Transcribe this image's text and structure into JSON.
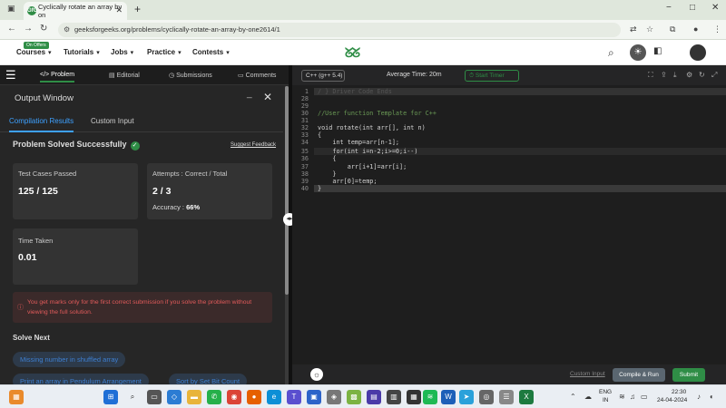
{
  "browser": {
    "tab_title": "Cyclically rotate an array by on",
    "tab_favicon": "GfG",
    "new_tab": "+",
    "url": "geeksforgeeks.org/problems/cyclically-rotate-an-array-by-one2614/1",
    "win_min": "−",
    "win_max": "□",
    "win_close": "✕"
  },
  "sitenav": {
    "offer_badge": "On Offers",
    "courses": "Courses",
    "tutorials": "Tutorials",
    "jobs": "Jobs",
    "practice": "Practice",
    "contests": "Contests",
    "caret": "▾"
  },
  "leftpane": {
    "tabs": {
      "problem": "</> Problem",
      "editorial": "Editorial",
      "submissions": "Submissions",
      "comments": "Comments"
    },
    "output_window": {
      "title": "Output Window",
      "minimize": "_",
      "close": "✕"
    },
    "subtabs": {
      "compilation": "Compilation Results",
      "custom_input": "Custom Input"
    },
    "status": "Problem Solved Successfully",
    "status_check": "✓",
    "suggest_feedback": "Suggest Feedback",
    "cards": {
      "test_cases_label": "Test Cases Passed",
      "test_cases_value": "125 / 125",
      "attempts_label": "Attempts : Correct / Total",
      "attempts_value": "2 / 3",
      "accuracy_label": "Accuracy :",
      "accuracy_value": "66%",
      "time_label": "Time Taken",
      "time_value": "0.01"
    },
    "warning_icon": "ⓘ",
    "warning": "You get marks only for the first correct submission if you solve the problem without viewing the full solution.",
    "solve_next": "Solve Next",
    "suggestions": [
      "Missing number in shuffled array",
      "Print an array in Pendulum Arrangement",
      "Sort by Set Bit Count"
    ]
  },
  "editor": {
    "language": "C++ (g++ 5.4)",
    "average_time": "Average Time: 20m",
    "timer": "Start Timer",
    "lines": [
      {
        "n": "1",
        "code": "/ } Driver Code Ends"
      },
      {
        "n": "28",
        "code": ""
      },
      {
        "n": "29",
        "code": ""
      },
      {
        "n": "30",
        "code": "//User function Template for C++"
      },
      {
        "n": "31",
        "code": ""
      },
      {
        "n": "32",
        "code": "void rotate(int arr[], int n)"
      },
      {
        "n": "33",
        "code": "{"
      },
      {
        "n": "34",
        "code": "    int temp=arr[n-1];"
      },
      {
        "n": "35",
        "code": "    for(int i=n-2;i>=0;i--)"
      },
      {
        "n": "36",
        "code": "    {"
      },
      {
        "n": "37",
        "code": "        arr[i+1]=arr[i];"
      },
      {
        "n": "38",
        "code": "    }"
      },
      {
        "n": "39",
        "code": "    arr[0]=temp;"
      },
      {
        "n": "40",
        "code": "}"
      }
    ],
    "custom_input": "Custom Input",
    "compile_run": "Compile & Run",
    "submit": "Submit"
  },
  "taskbar": {
    "lang_top": "ENG",
    "lang_bottom": "IN",
    "time": "22:30",
    "date": "24-04-2024"
  },
  "colors": {
    "accent_green": "#2f8d46",
    "accent_blue": "#3ea1ff",
    "warning_red": "#e35b5b"
  }
}
